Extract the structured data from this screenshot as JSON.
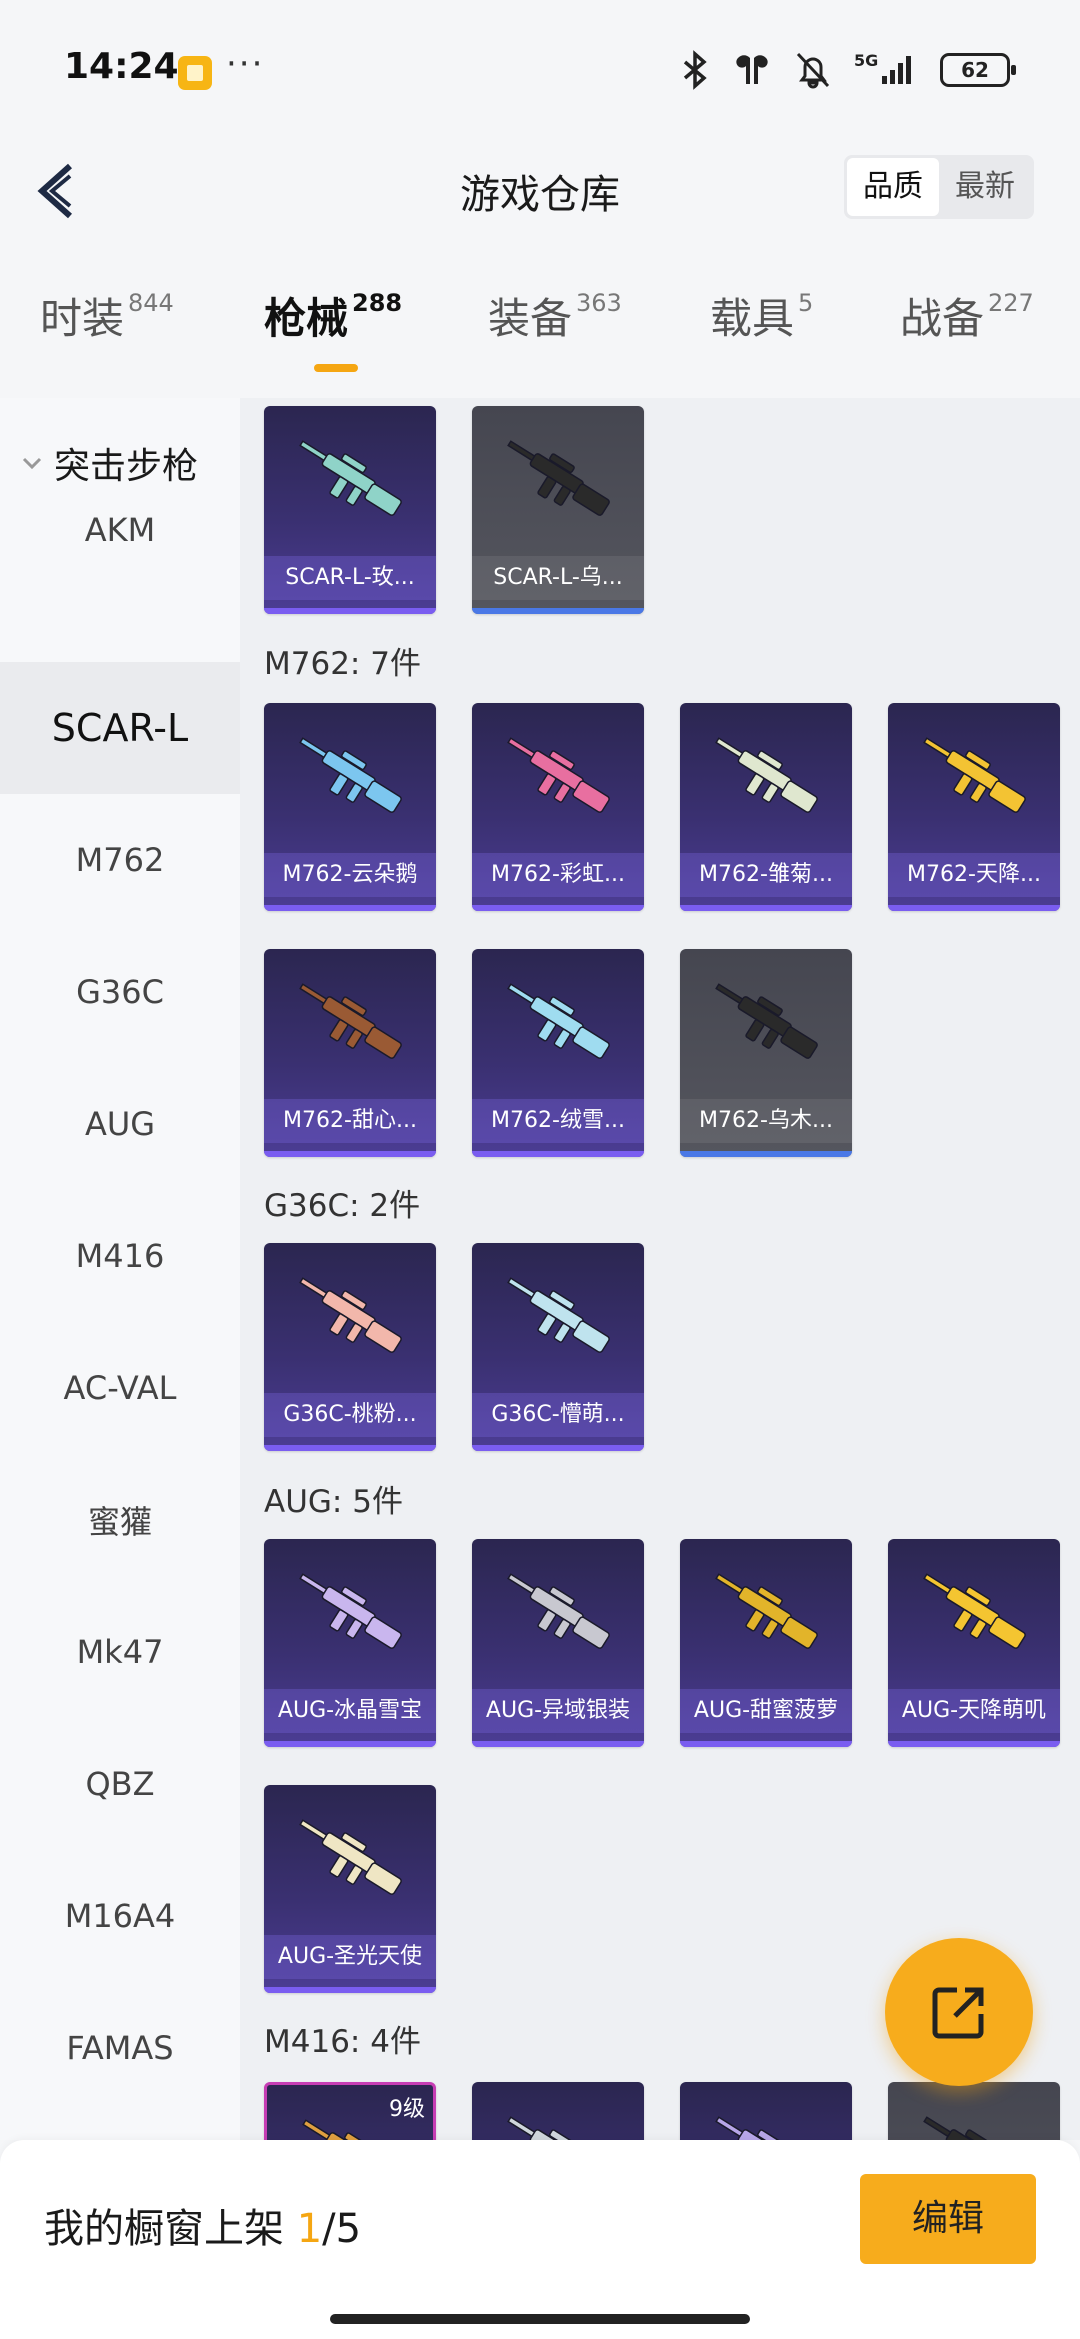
{
  "status_bar": {
    "time": "14:24",
    "dots": "···",
    "network": "5G",
    "battery": "62"
  },
  "nav": {
    "title": "游戏仓库",
    "sort_options": [
      "品质",
      "最新"
    ],
    "active_sort": "品质"
  },
  "tabs": [
    {
      "label": "时装",
      "count": "844"
    },
    {
      "label": "枪械",
      "count": "288"
    },
    {
      "label": "装备",
      "count": "363"
    },
    {
      "label": "载具",
      "count": "5"
    },
    {
      "label": "战备",
      "count": "227"
    }
  ],
  "active_tab": "枪械",
  "sidebar": {
    "group_label": "突击步枪",
    "items": [
      "AKM",
      "SCAR-L",
      "M762",
      "G36C",
      "AUG",
      "M416",
      "AC-VAL",
      "蜜獾",
      "Mk47",
      "QBZ",
      "M16A4",
      "FAMAS"
    ],
    "active_item": "SCAR-L"
  },
  "sections": [
    {
      "title": "",
      "cards": [
        {
          "name": "SCAR-L-玫...",
          "style": "purple",
          "gun_color": "#8fd3c8"
        },
        {
          "name": "SCAR-L-乌...",
          "style": "grey",
          "gun_color": "#2a2a2a"
        }
      ]
    },
    {
      "title": "M762: 7件",
      "cards": [
        {
          "name": "M762-云朵鹅",
          "style": "purple",
          "gun_color": "#7cc6ef"
        },
        {
          "name": "M762-彩虹...",
          "style": "purple",
          "gun_color": "#e86fa0"
        },
        {
          "name": "M762-雏菊...",
          "style": "purple",
          "gun_color": "#dfe7cf"
        },
        {
          "name": "M762-天降...",
          "style": "purple",
          "gun_color": "#f3c333"
        },
        {
          "name": "M762-甜心...",
          "style": "purple",
          "gun_color": "#9a5a34"
        },
        {
          "name": "M762-绒雪...",
          "style": "purple",
          "gun_color": "#9fdcf0"
        },
        {
          "name": "M762-乌木...",
          "style": "grey",
          "gun_color": "#2a2a2a"
        }
      ]
    },
    {
      "title": "G36C: 2件",
      "cards": [
        {
          "name": "G36C-桃粉...",
          "style": "purple",
          "gun_color": "#f2b7ab"
        },
        {
          "name": "G36C-懵萌...",
          "style": "purple",
          "gun_color": "#bfe3ee"
        }
      ]
    },
    {
      "title": "AUG: 5件",
      "cards": [
        {
          "name": "AUG-冰晶雪宝",
          "style": "purple",
          "gun_color": "#c9b6ee"
        },
        {
          "name": "AUG-异域银装",
          "style": "purple",
          "gun_color": "#c8c8d0"
        },
        {
          "name": "AUG-甜蜜菠萝",
          "style": "purple",
          "gun_color": "#e2b42a"
        },
        {
          "name": "AUG-天降萌叽",
          "style": "purple",
          "gun_color": "#f4c531"
        },
        {
          "name": "AUG-圣光天使",
          "style": "purple",
          "gun_color": "#efe6c4"
        }
      ]
    },
    {
      "title": "M416: 4件",
      "cards": [
        {
          "name": "",
          "level": "9级",
          "style": "top9",
          "gun_color": "#e0a040"
        },
        {
          "name": "",
          "style": "purple",
          "gun_color": "#cfd6dc"
        },
        {
          "name": "",
          "style": "purple",
          "gun_color": "#b7a6e8"
        },
        {
          "name": "",
          "style": "grey",
          "gun_color": "#2a2a2a"
        }
      ]
    }
  ],
  "bottom": {
    "label": "我的橱窗上架",
    "count_current": "1",
    "count_total": "/5",
    "edit_label": "编辑"
  }
}
